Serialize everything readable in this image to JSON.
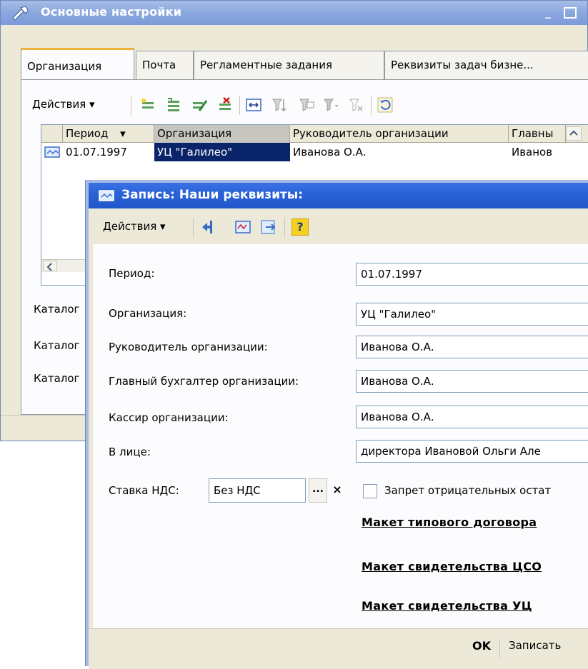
{
  "main_window": {
    "title": "Основные настройки",
    "minimize_glyph": "_",
    "tabs": [
      "Организация",
      "Почта",
      "Регламентные задания",
      "Реквизиты задач бизне..."
    ],
    "toolbar": {
      "actions_label": "Действия ▾"
    },
    "grid": {
      "columns": [
        "Период",
        "Организация",
        "Руководитель организации",
        "Главны"
      ],
      "period_sort_glyph": "▾",
      "rows": [
        {
          "period": "01.07.1997",
          "organization": "УЦ \"Галилео\"",
          "head": "Иванова О.А.",
          "chief": "Иванов"
        }
      ]
    },
    "katalog_labels": [
      "Каталог",
      "Каталог",
      "Каталог"
    ]
  },
  "dialog": {
    "title": "Запись: Наши реквизиты:",
    "toolbar": {
      "actions_label": "Действия ▾",
      "help_glyph": "?"
    },
    "fields": {
      "period": {
        "label": "Период:",
        "value": "01.07.1997"
      },
      "organization": {
        "label": "Организация:",
        "value": "УЦ \"Галилео\""
      },
      "head": {
        "label": "Руководитель организации:",
        "value": "Иванова О.А."
      },
      "chief_accountant": {
        "label": "Главный бухгалтер организации:",
        "value": "Иванова О.А."
      },
      "cashier": {
        "label": "Кассир организации:",
        "value": "Иванова О.А."
      },
      "in_person": {
        "label": "В лице:",
        "value": "директора Ивановой Ольги Але"
      }
    },
    "vat": {
      "label": "Ставка НДС:",
      "value": "Без НДС",
      "select_glyph": "...",
      "clear_glyph": "×"
    },
    "negative_stock": {
      "label": "Запрет отрицательных остат",
      "checked": false
    },
    "links": [
      "Макет типового договора",
      "Макет свидетельства ЦСО",
      "Макет свидетельства УЦ"
    ],
    "footer": {
      "ok_label": "OK",
      "save_label": "Записать"
    }
  },
  "colors": {
    "main_title_gradient": "#8aa7de",
    "dialog_title_gradient": "#2a62d8",
    "selected_cell": "#0a246a",
    "window_bg": "#ece9d8"
  }
}
